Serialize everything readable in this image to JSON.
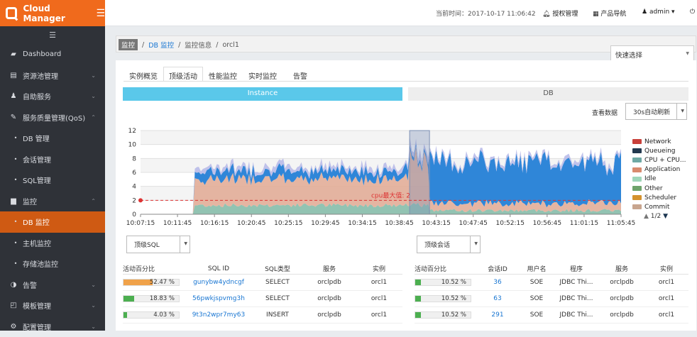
{
  "brand": {
    "title": "Cloud Manager",
    "menu_icon": "☰"
  },
  "sidebar": {
    "collapse_icon": "☰",
    "items": [
      {
        "icon": "▰",
        "label": "Dashboard",
        "caret": ""
      },
      {
        "icon": "▤",
        "label": "资源池管理",
        "caret": "⌄"
      },
      {
        "icon": "♟",
        "label": "自助服务",
        "caret": "⌄"
      },
      {
        "icon": "✎",
        "label": "服务质量管理(QoS)",
        "caret": "⌃"
      },
      {
        "icon": "•",
        "label": "DB 管理",
        "caret": "",
        "sub": true
      },
      {
        "icon": "•",
        "label": "会话管理",
        "caret": "",
        "sub": true
      },
      {
        "icon": "•",
        "label": "SQL管理",
        "caret": "",
        "sub": true
      },
      {
        "icon": "▆",
        "label": "监控",
        "caret": "⌃"
      },
      {
        "icon": "•",
        "label": "DB 监控",
        "caret": "",
        "sub": true,
        "active": true
      },
      {
        "icon": "•",
        "label": "主机监控",
        "caret": "",
        "sub": true
      },
      {
        "icon": "•",
        "label": "存储池监控",
        "caret": "",
        "sub": true
      },
      {
        "icon": "◑",
        "label": "告警",
        "caret": "⌄"
      },
      {
        "icon": "◰",
        "label": "模板管理",
        "caret": "⌄"
      },
      {
        "icon": "⚙",
        "label": "配置管理",
        "caret": "⌄"
      }
    ]
  },
  "topbar": {
    "time": "当前时间：2017-10-17 11:06:42",
    "auth": "授权管理",
    "products": "产品导航",
    "user": "admin"
  },
  "breadcrumb": {
    "root": "监控",
    "link": "DB 监控",
    "info": "监控信息",
    "current": "orcl1",
    "sep": "/"
  },
  "quick_select": "快速选择",
  "tabs": [
    "实例概览",
    "顶级活动",
    "性能监控",
    "实时监控",
    "告警"
  ],
  "segments": [
    "Instance",
    "DB"
  ],
  "view_data": "查看数据",
  "refresh": "30s自动刷新",
  "chart_data": {
    "type": "area",
    "ylim": [
      0,
      12
    ],
    "yticks": [
      "0",
      "2",
      "4",
      "6",
      "8",
      "10",
      "12"
    ],
    "xticks": [
      "10:07:15",
      "10:11:45",
      "10:16:15",
      "10:20:45",
      "10:25:15",
      "10:29:45",
      "10:34:15",
      "10:38:45",
      "10:43:15",
      "10:47:45",
      "10:52:15",
      "10:56:45",
      "11:01:15",
      "11:05:45"
    ],
    "annotation": "cpu最大值: 2",
    "cpu_max": 2,
    "series": [
      {
        "name": "Network",
        "color": "#c9403a"
      },
      {
        "name": "Queueing",
        "color": "#23394f"
      },
      {
        "name": "CPU + CPU...",
        "color": "#6fa9a4"
      },
      {
        "name": "Application",
        "color": "#d98a6d"
      },
      {
        "name": "Idle",
        "color": "#9fd6b9"
      },
      {
        "name": "Other",
        "color": "#6ea36b"
      },
      {
        "name": "Scheduler",
        "color": "#d4922e"
      },
      {
        "name": "Commit",
        "color": "#c8a58e"
      }
    ],
    "page": "1/2"
  },
  "left_select": "顶级SQL",
  "right_select": "顶级会话",
  "sql_table": {
    "headers": [
      "活动百分比",
      "SQL ID",
      "SQL类型",
      "服务",
      "实例"
    ],
    "rows": [
      {
        "pct": "52.47 %",
        "pct_value": 0.5247,
        "color": "#f0a24a",
        "id": "gunybw4ydncgf",
        "type": "SELECT",
        "service": "orclpdb",
        "inst": "orcl1"
      },
      {
        "pct": "18.83 %",
        "pct_value": 0.1883,
        "color": "#4caf50",
        "id": "56pwkjspvmg3h",
        "type": "SELECT",
        "service": "orclpdb",
        "inst": "orcl1"
      },
      {
        "pct": "4.03 %",
        "pct_value": 0.0403,
        "color": "#4caf50",
        "id": "9t3n2wpr7my63",
        "type": "INSERT",
        "service": "orclpdb",
        "inst": "orcl1"
      }
    ]
  },
  "session_table": {
    "headers": [
      "活动百分比",
      "会话ID",
      "用户名",
      "程序",
      "服务",
      "实例"
    ],
    "rows": [
      {
        "pct": "10.52 %",
        "pct_value": 0.1052,
        "color": "#4caf50",
        "id": "36",
        "user": "SOE",
        "program": "JDBC Thi...",
        "service": "orclpdb",
        "inst": "orcl1"
      },
      {
        "pct": "10.52 %",
        "pct_value": 0.1052,
        "color": "#4caf50",
        "id": "63",
        "user": "SOE",
        "program": "JDBC Thi...",
        "service": "orclpdb",
        "inst": "orcl1"
      },
      {
        "pct": "10.52 %",
        "pct_value": 0.1052,
        "color": "#4caf50",
        "id": "291",
        "user": "SOE",
        "program": "JDBC Thi...",
        "service": "orclpdb",
        "inst": "orcl1"
      }
    ]
  }
}
